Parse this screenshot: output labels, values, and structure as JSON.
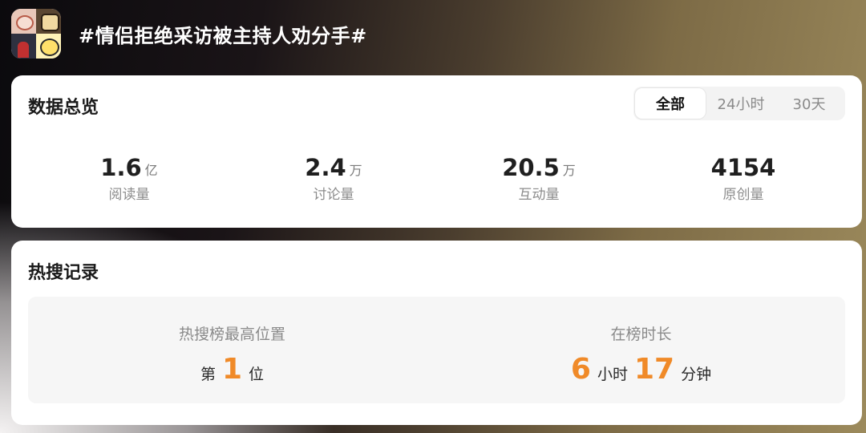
{
  "header": {
    "title": "#情侣拒绝采访被主持人劝分手#",
    "thumbnail_icon": "topic-thumbnail-collage"
  },
  "overview": {
    "title": "数据总览",
    "tabs": [
      {
        "label": "全部",
        "active": true
      },
      {
        "label": "24小时",
        "active": false
      },
      {
        "label": "30天",
        "active": false
      }
    ],
    "stats": [
      {
        "value": "1.6",
        "unit": "亿",
        "label": "阅读量"
      },
      {
        "value": "2.4",
        "unit": "万",
        "label": "讨论量"
      },
      {
        "value": "20.5",
        "unit": "万",
        "label": "互动量"
      },
      {
        "value": "4154",
        "unit": "",
        "label": "原创量"
      }
    ]
  },
  "hot_record": {
    "title": "热搜记录",
    "highest_position": {
      "label": "热搜榜最高位置",
      "prefix": "第",
      "number": "1",
      "suffix": "位"
    },
    "duration": {
      "label": "在榜时长",
      "hours": "6",
      "hours_unit": "小时",
      "minutes": "17",
      "minutes_unit": "分钟"
    }
  },
  "colors": {
    "accent": "#f08a28",
    "card_bg": "#ffffff",
    "panel_bg": "#f6f6f6"
  }
}
